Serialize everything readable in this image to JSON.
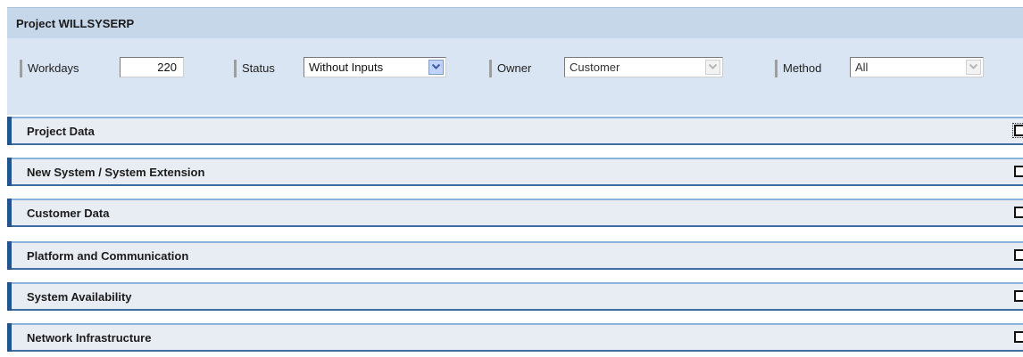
{
  "project": {
    "title": "Project WILLSYSERP"
  },
  "filters": {
    "workdays": {
      "label": "Workdays",
      "value": "220"
    },
    "status": {
      "label": "Status",
      "value": "Without Inputs"
    },
    "owner": {
      "label": "Owner",
      "value": "Customer"
    },
    "method": {
      "label": "Method",
      "value": "All"
    }
  },
  "sections": [
    {
      "title": "Project Data"
    },
    {
      "title": "New System / System Extension"
    },
    {
      "title": "Customer Data"
    },
    {
      "title": "Platform and Communication"
    },
    {
      "title": "System Availability"
    },
    {
      "title": "Network Infrastructure"
    }
  ],
  "colors": {
    "title_bar_bg": "#c6d7ea",
    "filter_bar_bg": "#d9e5f2",
    "section_bg": "#e8edf3",
    "section_accent": "#24548e",
    "section_border": "#3e6da3"
  }
}
